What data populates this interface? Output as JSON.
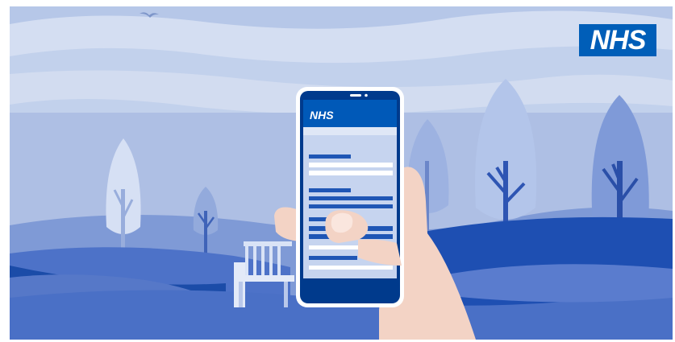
{
  "brand": {
    "logo_text": "NHS",
    "phone_header_text": "NHS"
  },
  "colors": {
    "nhs_blue": "#005eb8",
    "sky": "#c5d3ed",
    "hill_dark": "#1a4fb0",
    "tree_light": "#b7c8ea",
    "skin": "#f2d4c7"
  },
  "icons": [
    "bird-icon",
    "bench-icon",
    "tree-icon",
    "hand-icon",
    "phone-icon"
  ]
}
